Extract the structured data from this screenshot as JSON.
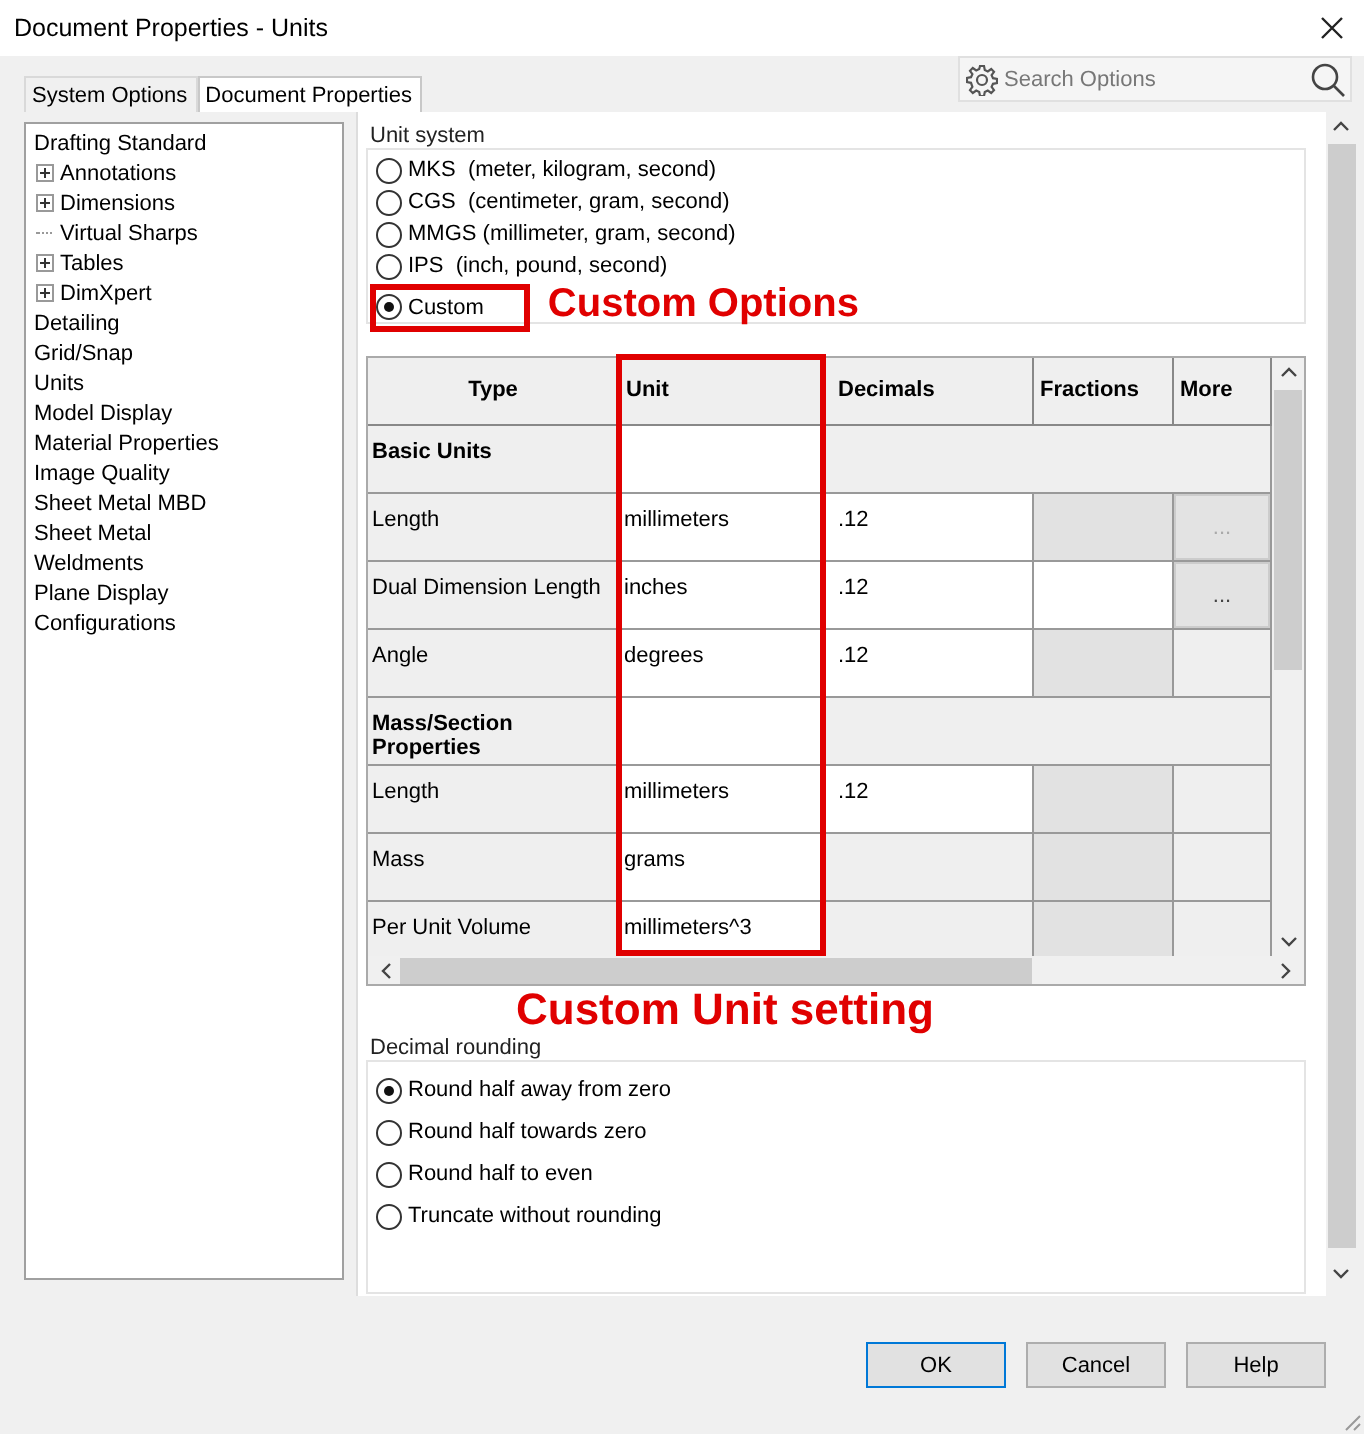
{
  "window": {
    "title": "Document Properties - Units"
  },
  "tabs": [
    {
      "label": "System Options",
      "selected": false
    },
    {
      "label": "Document Properties",
      "selected": true
    }
  ],
  "search": {
    "placeholder": "Search Options"
  },
  "tree": [
    {
      "label": "Drafting Standard",
      "children": [
        {
          "label": "Annotations",
          "kind": "expandable"
        },
        {
          "label": "Dimensions",
          "kind": "expandable"
        },
        {
          "label": "Virtual Sharps",
          "kind": "leaf"
        },
        {
          "label": "Tables",
          "kind": "expandable"
        },
        {
          "label": "DimXpert",
          "kind": "expandable"
        }
      ]
    },
    {
      "label": "Detailing"
    },
    {
      "label": "Grid/Snap"
    },
    {
      "label": "Units"
    },
    {
      "label": "Model Display"
    },
    {
      "label": "Material Properties"
    },
    {
      "label": "Image Quality"
    },
    {
      "label": "Sheet Metal MBD"
    },
    {
      "label": "Sheet Metal"
    },
    {
      "label": "Weldments"
    },
    {
      "label": "Plane Display"
    },
    {
      "label": "Configurations"
    }
  ],
  "unit_system": {
    "label": "Unit system",
    "callout": "Custom Options",
    "options": [
      {
        "label": "MKS  (meter, kilogram, second)",
        "selected": false,
        "highlighted": false
      },
      {
        "label": "CGS  (centimeter, gram, second)",
        "selected": false,
        "highlighted": false
      },
      {
        "label": "MMGS (millimeter, gram, second)",
        "selected": false,
        "highlighted": false
      },
      {
        "label": "IPS  (inch, pound, second)",
        "selected": false,
        "highlighted": false
      },
      {
        "label": "Custom",
        "selected": true,
        "highlighted": true
      }
    ]
  },
  "units_table": {
    "callout": "Custom Unit setting",
    "columns": [
      {
        "label": "Type",
        "highlighted": false
      },
      {
        "label": "Unit",
        "highlighted": true
      },
      {
        "label": "Decimals",
        "highlighted": false
      },
      {
        "label": "Fractions",
        "highlighted": false
      },
      {
        "label": "More",
        "highlighted": false
      }
    ],
    "rows": [
      {
        "kind": "group",
        "type": "Basic Units"
      },
      {
        "kind": "unit",
        "type": "Length",
        "unit": "millimeters",
        "decimals": ".12",
        "fractions_enabled": false,
        "more": {
          "label": "...",
          "disabled": true
        }
      },
      {
        "kind": "unit",
        "type": "Dual Dimension Length",
        "unit": "inches",
        "decimals": ".12",
        "fractions_enabled": true,
        "more": {
          "label": "...",
          "disabled": false
        }
      },
      {
        "kind": "unit",
        "type": "Angle",
        "unit": "degrees",
        "decimals": ".12",
        "fractions_enabled": false
      },
      {
        "kind": "group",
        "type": "Mass/Section Properties"
      },
      {
        "kind": "unit",
        "type": "Length",
        "unit": "millimeters",
        "decimals": ".12",
        "fractions_enabled": false
      },
      {
        "kind": "unit",
        "type": "Mass",
        "unit": "grams",
        "fractions_enabled": false
      },
      {
        "kind": "unit",
        "type": "Per Unit Volume",
        "unit": "millimeters^3",
        "fractions_enabled": false
      }
    ]
  },
  "decimal_rounding": {
    "label": "Decimal rounding",
    "options": [
      {
        "label": "Round half away from zero",
        "selected": true
      },
      {
        "label": "Round half towards zero",
        "selected": false
      },
      {
        "label": "Round half to even",
        "selected": false
      },
      {
        "label": "Truncate without rounding",
        "selected": false
      }
    ]
  },
  "buttons": [
    {
      "label": "OK",
      "default": true
    },
    {
      "label": "Cancel",
      "default": false
    },
    {
      "label": "Help",
      "default": false
    }
  ]
}
